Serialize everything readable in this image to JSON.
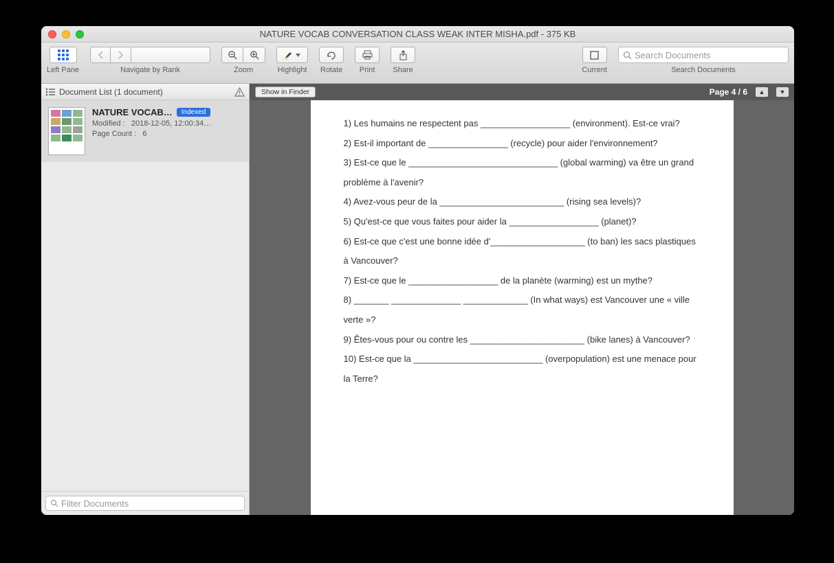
{
  "window": {
    "title": "NATURE VOCAB CONVERSATION CLASS WEAK INTER MISHA.pdf - 375 KB"
  },
  "toolbar": {
    "left_pane_label": "Left Pane",
    "navigate_label": "Navigate by Rank",
    "zoom_label": "Zoom",
    "highlight_label": "Highlight",
    "rotate_label": "Rotate",
    "print_label": "Print",
    "share_label": "Share",
    "current_label": "Current",
    "search_label": "Search Documents",
    "search_placeholder": "Search Documents"
  },
  "sidebar": {
    "header": "Document List (1 document)",
    "doc": {
      "title": "NATURE VOCAB…",
      "badge": "Indexed",
      "modified_label": "Modified :",
      "modified_value": "2018-12-05, 12:00:34…",
      "pagecount_label": "Page Count :",
      "pagecount_value": "6"
    },
    "filter_placeholder": "Filter Documents"
  },
  "main": {
    "show_in_finder": "Show in Finder",
    "page_indicator": "Page 4 / 6"
  },
  "document": {
    "lines": [
      "1) Les humains ne respectent pas __________________ (environment). Est-ce vrai?",
      "2) Est-il important de ________________ (recycle) pour aider l'environnement?",
      "3) Est-ce que le ______________________________ (global warming) va être un grand problème à l'avenir?",
      "4) Avez-vous peur de la _________________________ (rising sea levels)?",
      "5) Qu'est-ce que vous faites pour aider la __________________ (planet)?",
      "6) Est-ce que c'est une bonne idée d'___________________ (to ban) les sacs plastiques à Vancouver?",
      "7) Est-ce que le __________________ de la planète (warming) est un mythe?",
      "8) _______ ______________ _____________ (In what ways) est Vancouver une « ville verte »?",
      "9) Êtes-vous pour ou contre les _______________________ (bike lanes) à Vancouver?",
      "10) Est-ce que la __________________________ (overpopulation) est une menace pour la Terre?"
    ]
  }
}
